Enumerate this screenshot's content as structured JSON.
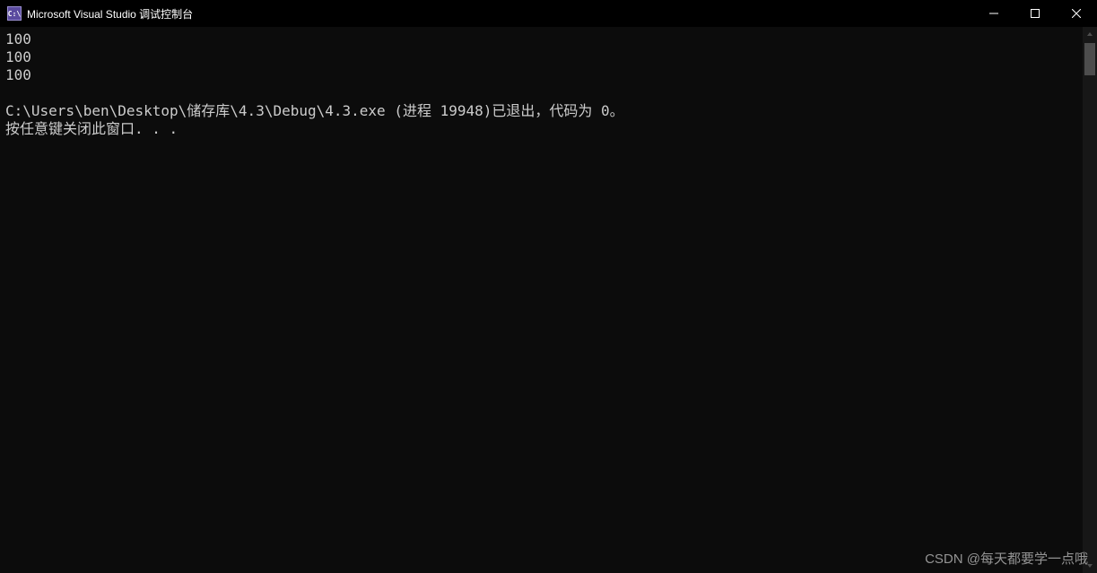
{
  "titlebar": {
    "icon_text": "C:\\",
    "title": "Microsoft Visual Studio 调试控制台"
  },
  "console": {
    "lines": [
      "100",
      "100",
      "100",
      "",
      "C:\\Users\\ben\\Desktop\\储存库\\4.3\\Debug\\4.3.exe (进程 19948)已退出，代码为 0。",
      "按任意键关闭此窗口. . ."
    ]
  },
  "watermark": "CSDN @每天都要学一点哦"
}
